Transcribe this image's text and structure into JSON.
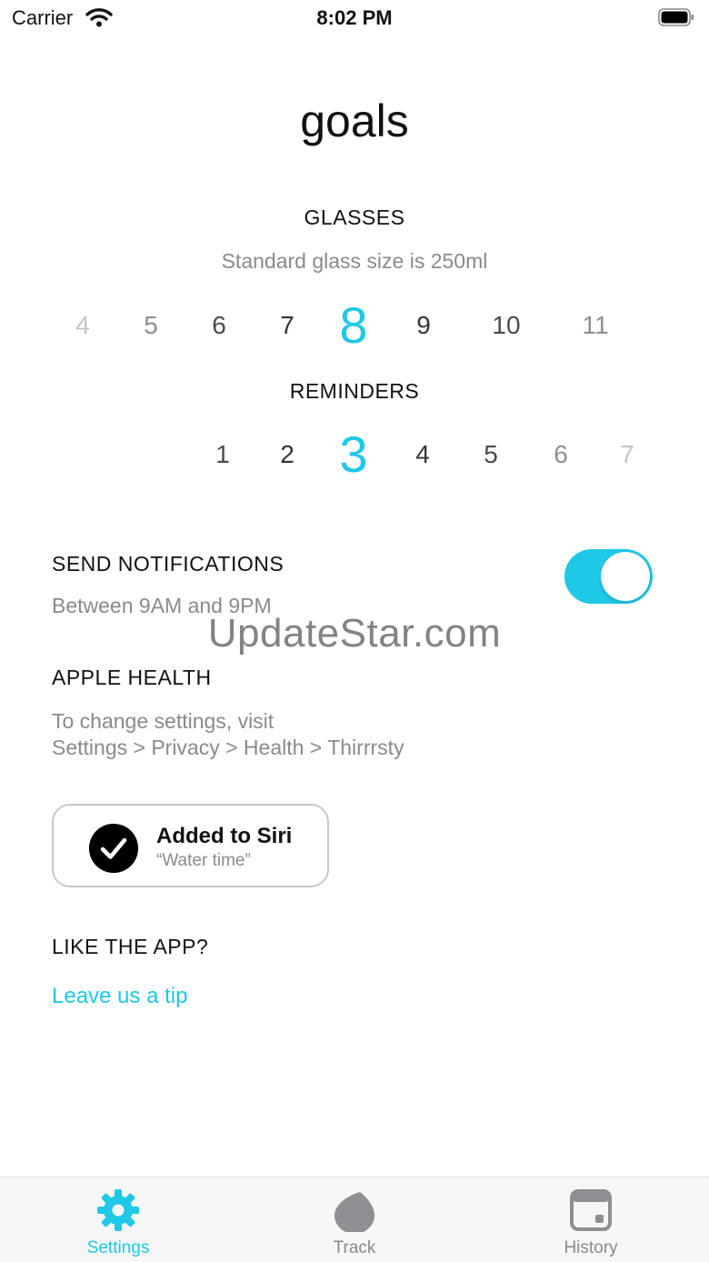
{
  "status_bar": {
    "carrier": "Carrier",
    "time": "8:02 PM"
  },
  "title": "goals",
  "glasses": {
    "heading": "GLASSES",
    "subtitle": "Standard glass size is 250ml",
    "values": [
      "4",
      "5",
      "6",
      "7",
      "8",
      "9",
      "10",
      "11"
    ],
    "selected": "8"
  },
  "reminders": {
    "heading": "REMINDERS",
    "values": [
      "1",
      "2",
      "3",
      "4",
      "5",
      "6",
      "7"
    ],
    "selected": "3"
  },
  "notifications": {
    "label": "SEND NOTIFICATIONS",
    "subtitle": "Between 9AM and 9PM",
    "enabled": true
  },
  "watermark": "UpdateStar.com",
  "apple_health": {
    "label": "APPLE HEALTH",
    "line1": "To change settings, visit",
    "line2": "Settings > Privacy > Health > Thirrrsty"
  },
  "siri": {
    "title": "Added to Siri",
    "phrase": "“Water time”"
  },
  "like_app": {
    "label": "LIKE THE APP?",
    "link": "Leave us a tip"
  },
  "tabs": [
    {
      "label": "Settings",
      "icon": "gear-icon",
      "active": true
    },
    {
      "label": "Track",
      "icon": "drop-icon",
      "active": false
    },
    {
      "label": "History",
      "icon": "calendar-icon",
      "active": false
    }
  ],
  "colors": {
    "accent": "#1ec8e6",
    "secondary_text": "#8a8a8e"
  }
}
